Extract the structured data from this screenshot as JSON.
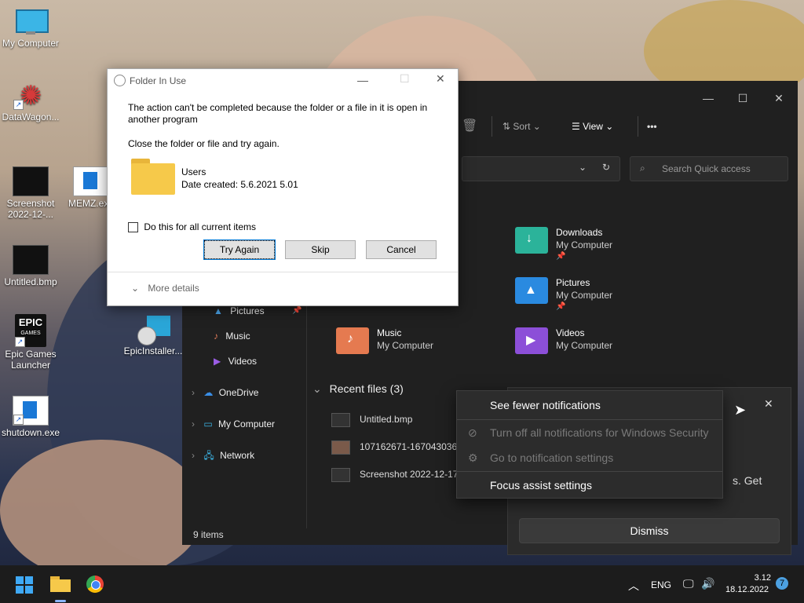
{
  "desktop": {
    "icons": [
      {
        "label": "My Computer"
      },
      {
        "label": "DataWagon..."
      },
      {
        "label": "Screenshot 2022-12-..."
      },
      {
        "label": "MEMZ.exe"
      },
      {
        "label": "Untitled.bmp"
      },
      {
        "label": "Epic Games Launcher"
      },
      {
        "label": "EpicInstaller..."
      },
      {
        "label": "shutdown.exe"
      }
    ]
  },
  "explorer": {
    "toolbar": {
      "sort": "Sort",
      "view": "View",
      "more": "•••"
    },
    "search_placeholder": "Search Quick access",
    "nav": [
      {
        "label": "Pictures"
      },
      {
        "label": "Music"
      },
      {
        "label": "Videos"
      },
      {
        "label": "OneDrive"
      },
      {
        "label": "My Computer"
      },
      {
        "label": "Network"
      }
    ],
    "tiles": [
      {
        "title": "Downloads",
        "sub": "My Computer"
      },
      {
        "title": "Pictures",
        "sub": "My Computer"
      },
      {
        "title": "Music",
        "sub": "My Computer"
      },
      {
        "title": "Videos",
        "sub": "My Computer"
      }
    ],
    "recent_header": "Recent files (3)",
    "recent": [
      {
        "name": "Untitled.bmp"
      },
      {
        "name": "107162671-1670430367..."
      },
      {
        "name": "Screenshot 2022-12-17"
      }
    ],
    "status": "9 items"
  },
  "dialog": {
    "title": "Folder In Use",
    "message": "The action can't be completed because the folder or a file in it is open in another program",
    "instruction": "Close the folder or file and try again.",
    "item_name": "Users",
    "item_date": "Date created: 5.6.2021 5.01",
    "checkbox_label": "Do this for all current items",
    "buttons": {
      "try_again": "Try Again",
      "skip": "Skip",
      "cancel": "Cancel"
    },
    "more_details": "More details"
  },
  "notification": {
    "partial_text": "s. Get",
    "dismiss": "Dismiss",
    "menu": {
      "fewer": "See fewer notifications",
      "turn_off": "Turn off all notifications for Windows Security",
      "goto_settings": "Go to notification settings",
      "focus": "Focus assist settings"
    }
  },
  "taskbar": {
    "lang": "ENG",
    "time": "3.12",
    "date": "18.12.2022",
    "badge": "7"
  },
  "colors": {
    "accent": "#0078d4",
    "folder": "#f6c94a"
  }
}
